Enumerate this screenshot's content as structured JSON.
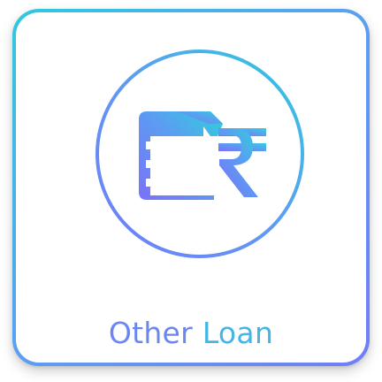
{
  "card": {
    "label_word1": "Other",
    "label_word2": "Loan",
    "icon": "card-rupee-icon",
    "colors": {
      "gradient_start": "#6f7df8",
      "gradient_mid": "#5f9bf3",
      "gradient_end": "#30c9de",
      "label_left": "#6a86ef",
      "label_right": "#45b4e6",
      "background": "#ffffff"
    }
  }
}
